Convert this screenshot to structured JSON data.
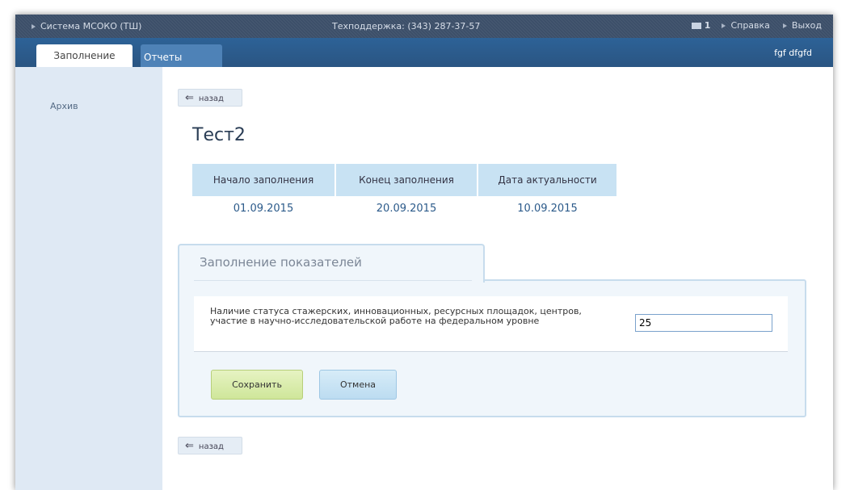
{
  "topbar": {
    "system": "Система МСОКО (ТШ)",
    "support": "Техподдержка: (343) 287-37-57",
    "mail_count": "1",
    "help": "Справка",
    "logout": "Выход"
  },
  "tabs": {
    "fill": "Заполнение",
    "reports": "Отчеты",
    "user": "fgf dfgfd"
  },
  "sidebar": {
    "archive": "Архив"
  },
  "back_label": "назад",
  "page_title": "Тест2",
  "dates": {
    "headers": [
      "Начало заполнения",
      "Конец заполнения",
      "Дата актуальности"
    ],
    "values": [
      "01.09.2015",
      "20.09.2015",
      "10.09.2015"
    ]
  },
  "panel": {
    "title": "Заполнение показателей",
    "indicator_label": "Наличие статуса стажерских, инновационных, ресурсных площадок, центров, участие в научно-исследовательской работе на федеральном уровне",
    "indicator_value": "25",
    "save": "Сохранить",
    "cancel": "Отмена"
  },
  "colors": {
    "topbar": "#3b4e68",
    "tabbar": "#2d6297",
    "sidebar": "#dfe9f4",
    "accent": "#c8e2f3"
  },
  "icons": {
    "back": "left-arrow-icon",
    "mail": "envelope-icon",
    "nav": "triangle-right-icon"
  }
}
